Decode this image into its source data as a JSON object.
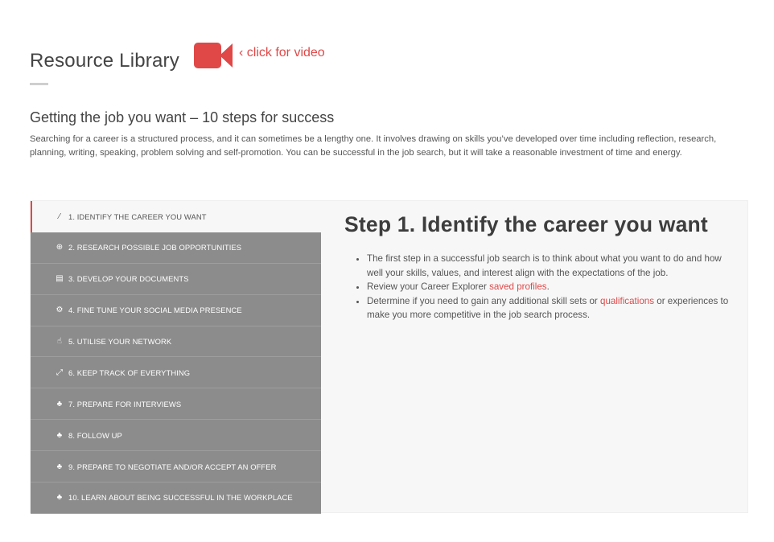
{
  "header": {
    "title": "Resource Library",
    "video_label": "‹ click for video",
    "video_icon": "video-camera-icon",
    "accent_color": "#e04848"
  },
  "section": {
    "heading": "Getting the job you want – 10 steps for success",
    "intro": "Searching for a career is a structured process, and it can sometimes be a lengthy one. It involves drawing on skills you’ve developed over time including reflection, research, planning, writing, speaking, problem solving and self-promotion. You can be successful in the job search, but it will take a reasonable investment of time and energy."
  },
  "tabs": [
    {
      "label": "1.  IDENTIFY THE CAREER YOU WANT",
      "icon": "wand-icon",
      "glyph": "⁄",
      "active": true
    },
    {
      "label": "2.  RESEARCH POSSIBLE JOB OPPORTUNITIES",
      "icon": "compass-icon",
      "glyph": "⊕",
      "active": false
    },
    {
      "label": "3.  DEVELOP YOUR DOCUMENTS",
      "icon": "document-stack-icon",
      "glyph": "▤",
      "active": false
    },
    {
      "label": "4.  FINE TUNE YOUR SOCIAL MEDIA PRESENCE",
      "icon": "gears-icon",
      "glyph": "⚙",
      "active": false
    },
    {
      "label": "5.  UTILISE YOUR NETWORK",
      "icon": "hand-icon",
      "glyph": "☝",
      "active": false
    },
    {
      "label": "6.  KEEP TRACK OF EVERYTHING",
      "icon": "expand-arrows-icon",
      "glyph": "⤢",
      "active": false
    },
    {
      "label": "7.  PREPARE FOR INTERVIEWS",
      "icon": "sitemap-icon",
      "glyph": "♣",
      "active": false
    },
    {
      "label": "8.  FOLLOW UP",
      "icon": "sitemap-icon",
      "glyph": "♣",
      "active": false
    },
    {
      "label": "9.  PREPARE TO NEGOTIATE AND/OR ACCEPT AN OFFER",
      "icon": "sitemap-icon",
      "glyph": "♣",
      "active": false
    },
    {
      "label": "10.  LEARN ABOUT BEING SUCCESSFUL IN THE WORKPLACE",
      "icon": "sitemap-icon",
      "glyph": "♣",
      "active": false
    }
  ],
  "content": {
    "title": "Step 1. Identify the career you want",
    "bullet1": "The first step in a successful job search is to think about what you want to do and how well your skills, values, and interest align with the expectations of the job.",
    "bullet2_prefix": "Review your Career Explorer ",
    "bullet2_link": "saved profiles",
    "bullet2_suffix": ".",
    "bullet3_prefix": "Determine if you need to gain any additional skill sets or ",
    "bullet3_link": "qualifications",
    "bullet3_suffix": " or experiences to make you more competitive in the job search process."
  }
}
